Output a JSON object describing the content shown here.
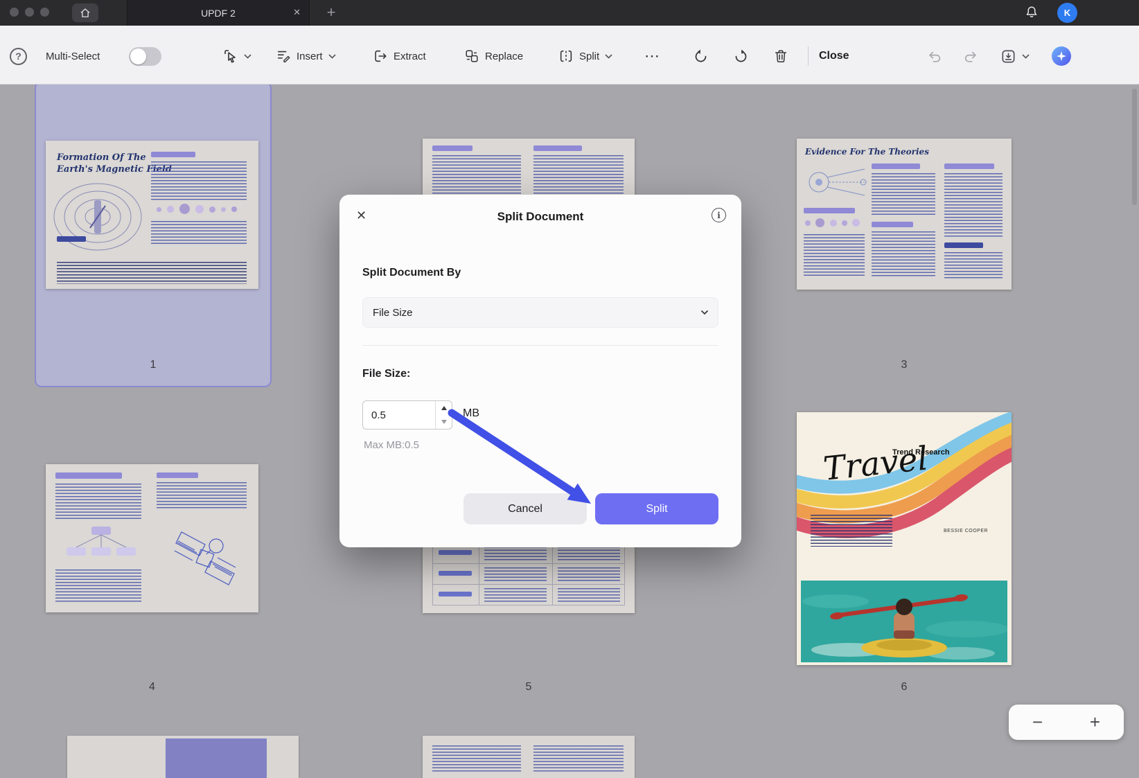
{
  "titlebar": {
    "tab_title": "UPDF 2",
    "avatar_initial": "K"
  },
  "icons": {
    "tab_close": "✕",
    "new_tab": "+",
    "more": "⋯",
    "close_x": "✕",
    "info": "i",
    "help": "?"
  },
  "toolbar": {
    "multi_select": "Multi-Select",
    "insert": "Insert",
    "extract": "Extract",
    "replace": "Replace",
    "split": "Split",
    "close": "Close"
  },
  "dialog": {
    "title": "Split Document",
    "section_by": "Split Document By",
    "dropdown_value": "File Size",
    "file_size_label": "File Size:",
    "file_size_value": "0.5",
    "unit": "MB",
    "max_hint": "Max MB:0.5",
    "cancel": "Cancel",
    "split": "Split"
  },
  "pages": {
    "p1": {
      "number": "1",
      "title_line1": "Formation Of The",
      "title_line2": "Earth's Magnetic Field"
    },
    "p3": {
      "number": "3",
      "title": "Evidence For The Theories"
    },
    "p4": {
      "number": "4"
    },
    "p5": {
      "number": "5"
    },
    "p6": {
      "number": "6",
      "magazine_title": "Travel",
      "magazine_tag": "Trend Research",
      "magazine_author": "BESSIE COOPER"
    }
  },
  "zoom": {
    "out": "−",
    "in": "+"
  },
  "colors": {
    "accent": "#6e6ef3",
    "selection": "#b3b3d2",
    "arrow": "#4150e6",
    "avatar": "#2e7cf0"
  }
}
